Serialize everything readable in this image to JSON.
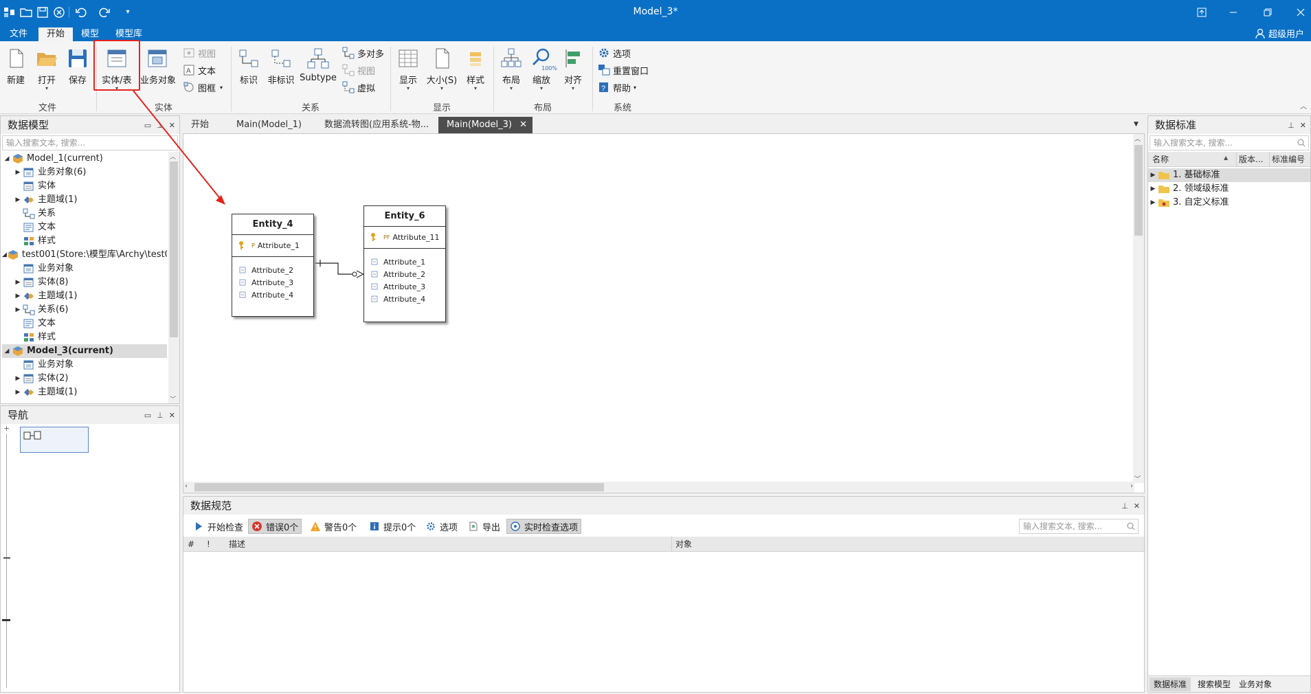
{
  "app": {
    "window_title": "Model_3*",
    "user_label": "超级用户"
  },
  "menu": {
    "items": [
      "文件",
      "开始",
      "模型",
      "模型库"
    ],
    "active": "开始"
  },
  "ribbon": {
    "file_group": {
      "label": "文件",
      "new": "新建",
      "open": "打开",
      "save": "保存"
    },
    "entity_group": {
      "label": "实体",
      "entity_table": "实体/表",
      "business_object": "业务对象",
      "view": "视图",
      "text": "文本",
      "frame": "图框"
    },
    "relation_group": {
      "label": "关系",
      "identifying": "标识",
      "non_identifying": "非标识",
      "subtype": "Subtype",
      "many_to_many": "多对多",
      "view": "视图",
      "virtual": "虚拟"
    },
    "display_group": {
      "label": "显示",
      "display": "显示",
      "size": "大小(S)",
      "style": "样式"
    },
    "layout_group": {
      "label": "布局",
      "layout": "布局",
      "zoom": "缩放",
      "zoom_badge": "100%",
      "align": "对齐"
    },
    "system_group": {
      "label": "系统",
      "options": "选项",
      "reset_window": "重置窗口",
      "help": "帮助"
    }
  },
  "left_panel": {
    "title": "数据模型",
    "search_placeholder": "输入搜索文本, 搜索...",
    "tree": [
      {
        "label": "Model_1(current)",
        "level": 0,
        "expanded": true,
        "icon": "model-icon"
      },
      {
        "label": "业务对象(6)",
        "level": 1,
        "expanded": false,
        "icon": "business-object-icon"
      },
      {
        "label": "实体",
        "level": 1,
        "expanded": null,
        "icon": "entity-icon"
      },
      {
        "label": "主题域(1)",
        "level": 1,
        "expanded": false,
        "icon": "subject-area-icon"
      },
      {
        "label": "关系",
        "level": 1,
        "expanded": null,
        "icon": "relation-icon"
      },
      {
        "label": "文本",
        "level": 1,
        "expanded": null,
        "icon": "text-icon"
      },
      {
        "label": "样式",
        "level": 1,
        "expanded": null,
        "icon": "style-icon"
      },
      {
        "label": "test001(Store:\\模型库\\Archy\\test0...",
        "level": 0,
        "expanded": true,
        "icon": "model-icon"
      },
      {
        "label": "业务对象",
        "level": 1,
        "expanded": null,
        "icon": "business-object-icon"
      },
      {
        "label": "实体(8)",
        "level": 1,
        "expanded": false,
        "icon": "entity-icon"
      },
      {
        "label": "主题域(1)",
        "level": 1,
        "expanded": false,
        "icon": "subject-area-icon"
      },
      {
        "label": "关系(6)",
        "level": 1,
        "expanded": false,
        "icon": "relation-icon"
      },
      {
        "label": "文本",
        "level": 1,
        "expanded": null,
        "icon": "text-icon"
      },
      {
        "label": "样式",
        "level": 1,
        "expanded": null,
        "icon": "style-icon"
      },
      {
        "label": "Model_3(current)",
        "level": 0,
        "expanded": true,
        "icon": "model-icon",
        "selected": true
      },
      {
        "label": "业务对象",
        "level": 1,
        "expanded": null,
        "icon": "business-object-icon"
      },
      {
        "label": "实体(2)",
        "level": 1,
        "expanded": false,
        "icon": "entity-icon"
      },
      {
        "label": "主题域(1)",
        "level": 1,
        "expanded": false,
        "icon": "subject-area-icon"
      }
    ]
  },
  "nav_panel": {
    "title": "导航"
  },
  "tabs": {
    "items": [
      "开始",
      "Main(Model_1)",
      "数据流转图(应用系统-物...",
      "Main(Model_3)"
    ],
    "active_index": 3
  },
  "diagram": {
    "entities": [
      {
        "name": "Entity_4",
        "keys": [
          {
            "label": "Attribute_1",
            "badge": "P"
          }
        ],
        "attributes": [
          "Attribute_2",
          "Attribute_3",
          "Attribute_4"
        ]
      },
      {
        "name": "Entity_6",
        "keys": [
          {
            "label": "Attribute_11",
            "badge": "PF"
          }
        ],
        "attributes": [
          "Attribute_1",
          "Attribute_2",
          "Attribute_3",
          "Attribute_4"
        ]
      }
    ]
  },
  "bottom_panel": {
    "title": "数据规范",
    "toolbar": {
      "start_check": "开始检查",
      "errors": "错误0个",
      "warnings": "警告0个",
      "hints": "提示0个",
      "options": "选项",
      "export": "导出",
      "realtime": "实时检查选项"
    },
    "search_placeholder": "输入搜索文本, 搜索...",
    "columns": [
      "#",
      "!",
      "描述",
      "对象"
    ]
  },
  "right_panel": {
    "title": "数据标准",
    "search_placeholder": "输入搜索文本, 搜索...",
    "columns": [
      "名称",
      "版本...",
      "标准编号"
    ],
    "items": [
      "1. 基础标准",
      "2. 领域级标准",
      "3. 自定义标准"
    ],
    "bottom_tabs": [
      "数据标准",
      "搜索模型",
      "业务对象"
    ]
  },
  "colors": {
    "titlebar": "#0a70c6",
    "highlight": "#e5231b",
    "tab_active": "#4d4d4d"
  }
}
